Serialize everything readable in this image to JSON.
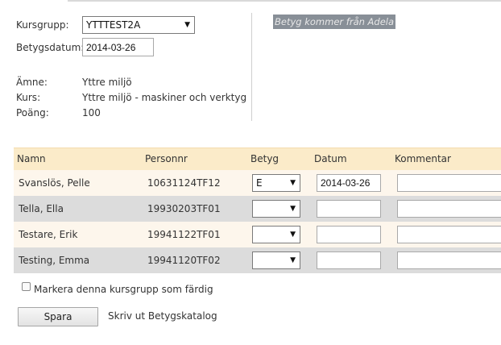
{
  "form": {
    "kursgrupp_label": "Kursgrupp:",
    "kursgrupp_value": "YTTTEST2A",
    "betygsdatum_label": "Betygsdatum:",
    "betygsdatum_value": "2014-03-26",
    "amne_label": "Ämne:",
    "amne_value": "Yttre miljö",
    "kurs_label": "Kurs:",
    "kurs_value": "Yttre miljö - maskiner och verktyg",
    "poang_label": "Poäng:",
    "poang_value": "100"
  },
  "note": "Betyg kommer från Adela",
  "table": {
    "headers": [
      "Namn",
      "Personnr",
      "Betyg",
      "Datum",
      "Kommentar"
    ],
    "rows": [
      {
        "namn": "Svanslös, Pelle",
        "personnr": "10631124TF12",
        "betyg": "E",
        "datum": "2014-03-26",
        "kommentar": ""
      },
      {
        "namn": "Tella, Ella",
        "personnr": "19930203TF01",
        "betyg": "",
        "datum": "",
        "kommentar": ""
      },
      {
        "namn": "Testare, Erik",
        "personnr": "19941122TF01",
        "betyg": "",
        "datum": "",
        "kommentar": ""
      },
      {
        "namn": "Testing, Emma",
        "personnr": "19941120TF02",
        "betyg": "",
        "datum": "",
        "kommentar": ""
      }
    ]
  },
  "checkbox_label": "Markera denna kursgrupp som färdig",
  "save_label": "Spara",
  "print_link": "Skriv ut Betygskatalog",
  "icons": {
    "dropdown": "chevron-down-icon"
  },
  "colors": {
    "header_bg": "#fbebc9",
    "row_odd": "#fdf6ec",
    "row_even": "#dcdcdc",
    "note_bg": "#888f97"
  }
}
